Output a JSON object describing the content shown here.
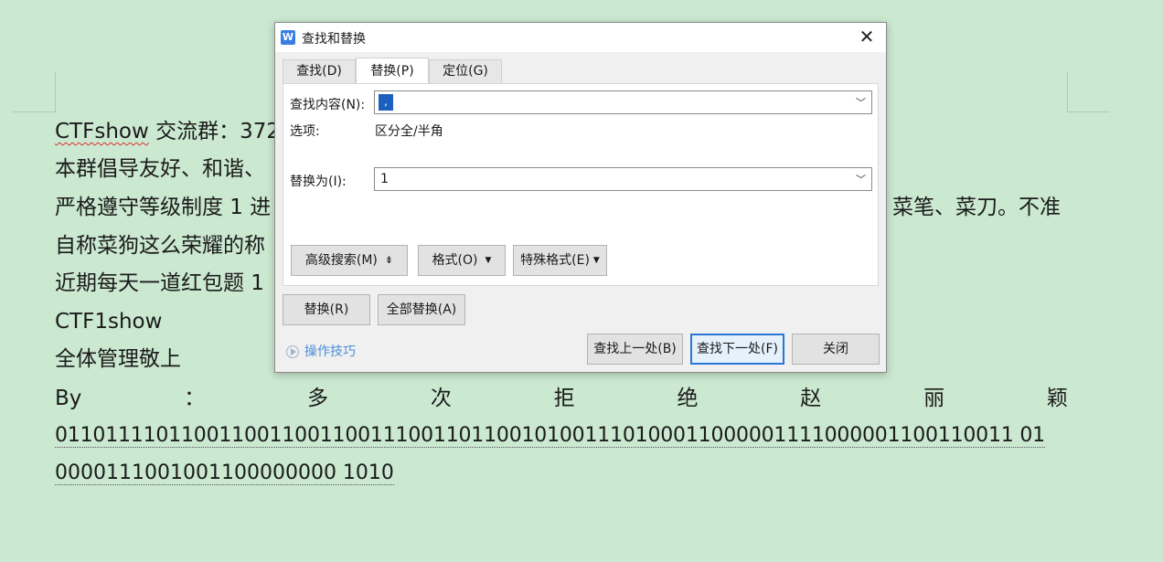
{
  "document": {
    "lines": [
      "CTFshow",
      " 交流群：372",
      "本群倡导友好、和谐、",
      "严格遵守等级制度 1 进",
      "菜笔、菜刀。不准",
      "自称菜狗这么荣耀的称",
      "近期每天一道红包题 1",
      "CTF1show",
      "全体管理敬上"
    ],
    "signature_words": [
      "By",
      "：",
      "多",
      "次",
      "拒",
      "绝",
      "赵",
      "丽",
      "颖"
    ],
    "binary_line_1": "0110111101100110011001100111001101100101001110100011000001111000001100110011 01",
    "binary_line_2": "0000111001001100000000 1010"
  },
  "dialog": {
    "app_icon": "W",
    "title": "查找和替换",
    "close_glyph": "✕",
    "tabs": [
      "查找(D)",
      "替换(P)",
      "定位(G)"
    ],
    "active_tab": 1,
    "find_label": "查找内容(N):",
    "find_value": ",",
    "options_label": "选项:",
    "options_value": "区分全/半角",
    "replace_label": "替换为(I):",
    "replace_value": "1",
    "advanced_search": "高级搜索(M)",
    "advanced_glyph": "⇟",
    "format": "格式(O)",
    "special_format": "特殊格式(E)",
    "replace_btn": "替换(R)",
    "replace_all_btn": "全部替换(A)",
    "tips": "操作技巧",
    "find_prev": "查找上一处(B)",
    "find_next": "查找下一处(F)",
    "close_btn": "关闭"
  },
  "colors": {
    "background": "#cbe8d0",
    "accent": "#2a78d6"
  }
}
